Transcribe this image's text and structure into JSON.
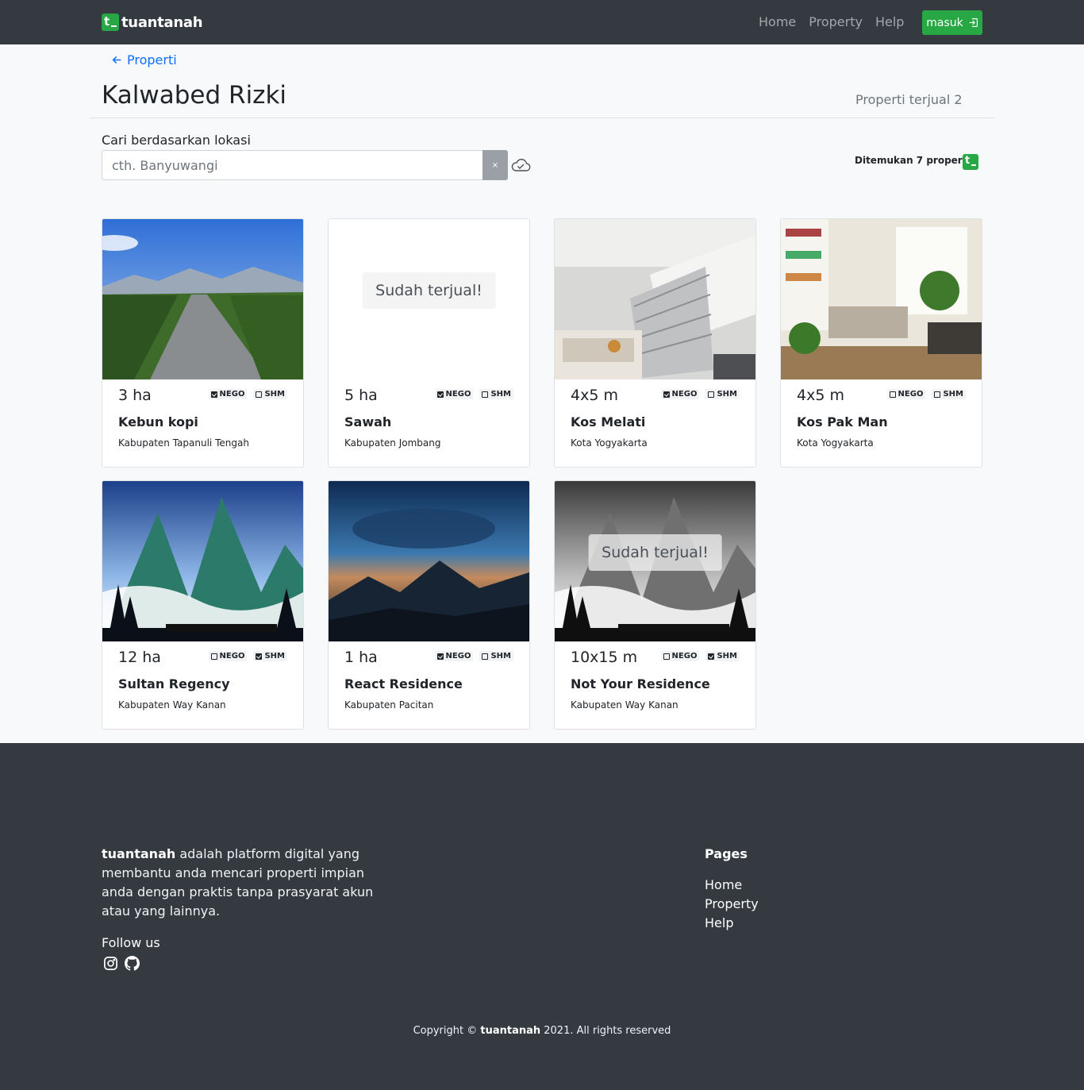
{
  "nav": {
    "brand_mark": "t",
    "brand": "tuantanah",
    "links": [
      "Home",
      "Property",
      "Help"
    ],
    "login": "masuk"
  },
  "header": {
    "back": "Properti",
    "title": "Kalwabed Rizki",
    "sold_count": "Properti terjual 2"
  },
  "search": {
    "label": "Cari berdasarkan lokasi",
    "placeholder": "cth. Banyuwangi",
    "value": "",
    "clear": "×",
    "found": "Ditemukan 7 properti"
  },
  "sold_label": "Sudah terjual!",
  "properties": [
    {
      "size": "3 ha",
      "name": "Kebun kopi",
      "location": "Kabupaten Tapanuli Tengah",
      "tag1": "NEGO",
      "tag2": "SHM",
      "nego": true,
      "shm": false,
      "sold": false
    },
    {
      "size": "5 ha",
      "name": "Sawah",
      "location": "Kabupaten Jombang",
      "tag1": "NEGO",
      "tag2": "SHM",
      "nego": true,
      "shm": false,
      "sold": true
    },
    {
      "size": "4x5 m",
      "name": "Kos Melati",
      "location": "Kota Yogyakarta",
      "tag1": "NEGO",
      "tag2": "SHM",
      "nego": true,
      "shm": false,
      "sold": false
    },
    {
      "size": "4x5 m",
      "name": "Kos Pak Man",
      "location": "Kota Yogyakarta",
      "tag1": "NEGO",
      "tag2": "SHM",
      "nego": false,
      "shm": false,
      "sold": false
    },
    {
      "size": "12 ha",
      "name": "Sultan Regency",
      "location": "Kabupaten Way Kanan",
      "tag1": "NEGO",
      "tag2": "SHM",
      "nego": false,
      "shm": true,
      "sold": false
    },
    {
      "size": "1 ha",
      "name": "React Residence",
      "location": "Kabupaten Pacitan",
      "tag1": "NEGO",
      "tag2": "SHM",
      "nego": true,
      "shm": false,
      "sold": false
    },
    {
      "size": "10x15 m",
      "name": "Not Your Residence",
      "location": "Kabupaten Way Kanan",
      "tag1": "NEGO",
      "tag2": "SHM",
      "nego": false,
      "shm": true,
      "sold": true
    }
  ],
  "footer": {
    "brand": "tuantanah",
    "about": " adalah platform digital yang membantu anda mencari properti impian anda dengan praktis tanpa prasyarat akun atau yang lainnya.",
    "follow": "Follow us",
    "pages_title": "Pages",
    "pages": [
      "Home",
      "Property",
      "Help"
    ],
    "copyright_pre": "Copyright © ",
    "copyright_post": " 2021. All rights reserved"
  },
  "colors": {
    "navbar": "#343a40",
    "accent": "#28a745",
    "link": "#0d6efd",
    "page_bg": "#f8f9fa"
  }
}
